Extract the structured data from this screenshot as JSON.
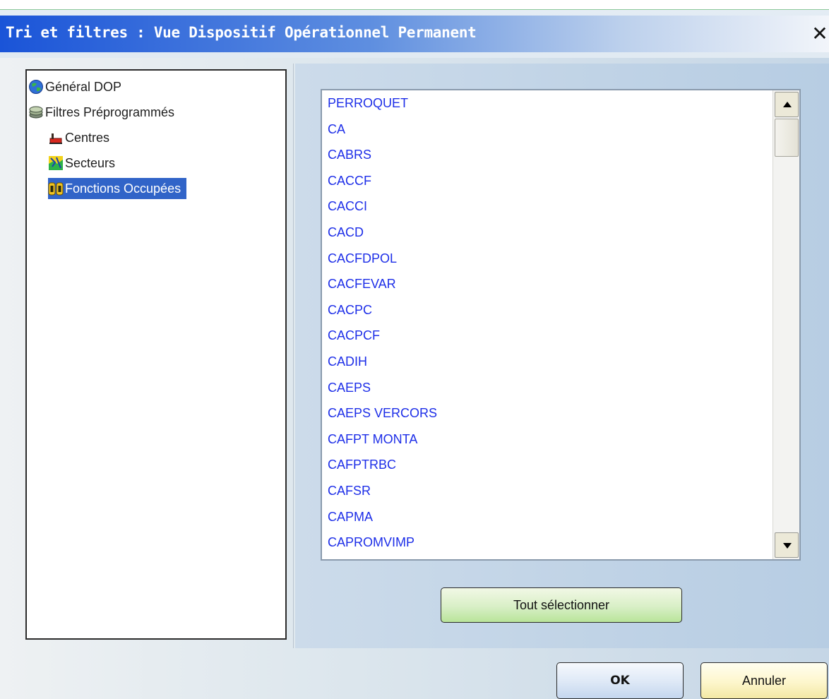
{
  "window": {
    "title": "Tri et filtres : Vue Dispositif Opérationnel Permanent",
    "close_label": "✕"
  },
  "tree": {
    "items": [
      {
        "label": "Général DOP",
        "icon": "globe-icon"
      },
      {
        "label": "Filtres Préprogrammés",
        "icon": "stacked-layers-icon"
      },
      {
        "label": "Centres",
        "icon": "fire-station-icon"
      },
      {
        "label": "Secteurs",
        "icon": "map-sector-icon"
      },
      {
        "label": "Fonctions Occupées",
        "icon": "functions-icon",
        "selected": true
      }
    ]
  },
  "list": {
    "items": [
      "PERROQUET",
      "CA",
      "CABRS",
      "CACCF",
      "CACCI",
      "CACD",
      "CACFDPOL",
      "CACFEVAR",
      "CACPC",
      "CACPCF",
      "CADIH",
      "CAEPS",
      "CAEPS VERCORS",
      "CAFPT MONTA",
      "CAFPTRBC",
      "CAFSR",
      "CAPMA",
      "CAPROMVIMP"
    ]
  },
  "buttons": {
    "select_all": "Tout sélectionner",
    "ok": "OK",
    "cancel": "Annuler"
  },
  "colors": {
    "title_gradient_start": "#1a54d8",
    "selection": "#3164c8",
    "list_text": "#1d2ee8"
  }
}
